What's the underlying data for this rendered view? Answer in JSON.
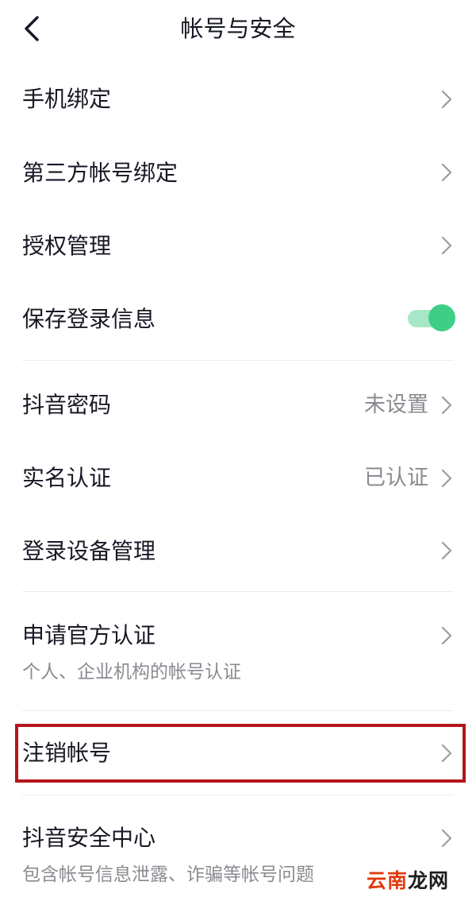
{
  "header": {
    "title": "帐号与安全"
  },
  "rows": {
    "phone_binding": {
      "label": "手机绑定"
    },
    "third_party_binding": {
      "label": "第三方帐号绑定"
    },
    "auth_management": {
      "label": "授权管理"
    },
    "save_login_info": {
      "label": "保存登录信息",
      "toggle_on": true
    },
    "douyin_password": {
      "label": "抖音密码",
      "value": "未设置"
    },
    "real_name_auth": {
      "label": "实名认证",
      "value": "已认证"
    },
    "login_device_management": {
      "label": "登录设备管理"
    },
    "official_verification": {
      "label": "申请官方认证",
      "sub": "个人、企业机构的帐号认证"
    },
    "cancel_account": {
      "label": "注销帐号"
    },
    "security_center": {
      "label": "抖音安全中心",
      "sub": "包含帐号信息泄露、诈骗等帐号问题"
    }
  },
  "watermark": {
    "part1": "云",
    "part2": "南",
    "part3": "龙网"
  },
  "colors": {
    "toggle_on": "#3fce86",
    "highlight_border": "#b5151b",
    "secondary_text": "#8a8b91"
  }
}
